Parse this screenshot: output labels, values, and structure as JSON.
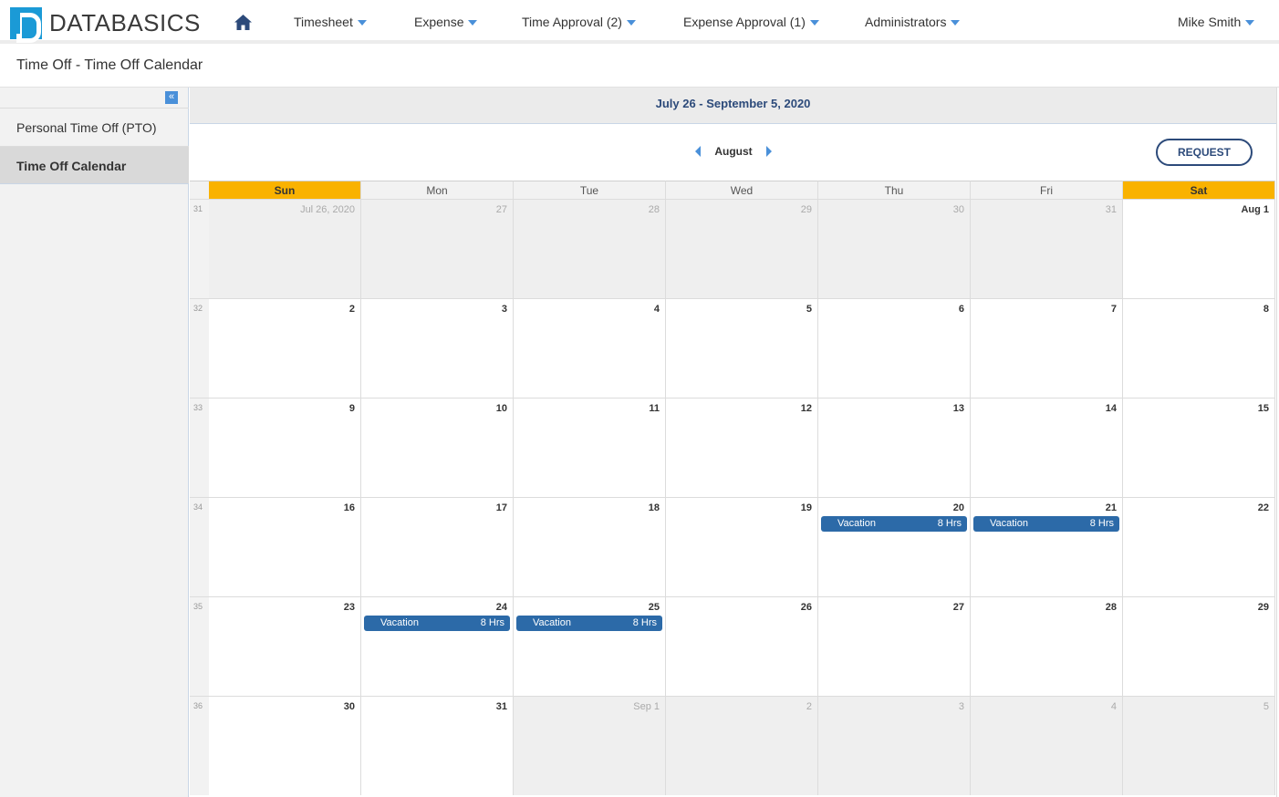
{
  "app": {
    "brand": "DATABASICS"
  },
  "nav": {
    "items": [
      {
        "label": "Timesheet"
      },
      {
        "label": "Expense"
      },
      {
        "label": "Time Approval (2)"
      },
      {
        "label": "Expense Approval (1)"
      },
      {
        "label": "Administrators"
      }
    ],
    "user": "Mike Smith"
  },
  "page": {
    "title": "Time Off - Time Off Calendar"
  },
  "sidebar": {
    "collapse_glyph": "«",
    "items": [
      {
        "label": "Personal Time Off (PTO)",
        "active": false
      },
      {
        "label": "Time Off Calendar",
        "active": true
      }
    ]
  },
  "calendar": {
    "range": "July 26 - September 5, 2020",
    "month": "August",
    "request_label": "REQUEST",
    "weekdays": [
      "Sun",
      "Mon",
      "Tue",
      "Wed",
      "Thu",
      "Fri",
      "Sat"
    ],
    "weeks": [
      {
        "week": "31",
        "days": [
          {
            "label": "Jul 26, 2020",
            "other": true
          },
          {
            "label": "27",
            "other": true
          },
          {
            "label": "28",
            "other": true
          },
          {
            "label": "29",
            "other": true
          },
          {
            "label": "30",
            "other": true
          },
          {
            "label": "31",
            "other": true
          },
          {
            "label": "Aug 1",
            "other": false
          }
        ]
      },
      {
        "week": "32",
        "days": [
          {
            "label": "2"
          },
          {
            "label": "3"
          },
          {
            "label": "4"
          },
          {
            "label": "5"
          },
          {
            "label": "6"
          },
          {
            "label": "7"
          },
          {
            "label": "8"
          }
        ]
      },
      {
        "week": "33",
        "days": [
          {
            "label": "9"
          },
          {
            "label": "10"
          },
          {
            "label": "11"
          },
          {
            "label": "12"
          },
          {
            "label": "13"
          },
          {
            "label": "14"
          },
          {
            "label": "15"
          }
        ]
      },
      {
        "week": "34",
        "days": [
          {
            "label": "16"
          },
          {
            "label": "17"
          },
          {
            "label": "18"
          },
          {
            "label": "19"
          },
          {
            "label": "20",
            "event": {
              "name": "Vacation",
              "hours": "8 Hrs"
            }
          },
          {
            "label": "21",
            "event": {
              "name": "Vacation",
              "hours": "8 Hrs"
            }
          },
          {
            "label": "22"
          }
        ]
      },
      {
        "week": "35",
        "days": [
          {
            "label": "23"
          },
          {
            "label": "24",
            "event": {
              "name": "Vacation",
              "hours": "8 Hrs"
            }
          },
          {
            "label": "25",
            "event": {
              "name": "Vacation",
              "hours": "8 Hrs"
            }
          },
          {
            "label": "26"
          },
          {
            "label": "27"
          },
          {
            "label": "28"
          },
          {
            "label": "29"
          }
        ]
      },
      {
        "week": "36",
        "days": [
          {
            "label": "30"
          },
          {
            "label": "31"
          },
          {
            "label": "Sep 1",
            "other": true
          },
          {
            "label": "2",
            "other": true
          },
          {
            "label": "3",
            "other": true
          },
          {
            "label": "4",
            "other": true
          },
          {
            "label": "5",
            "other": true
          }
        ]
      }
    ]
  },
  "colors": {
    "accent": "#4a90d9",
    "weekend": "#f9b200",
    "event": "#2c6aa8",
    "brand": "#1b9ad6"
  }
}
